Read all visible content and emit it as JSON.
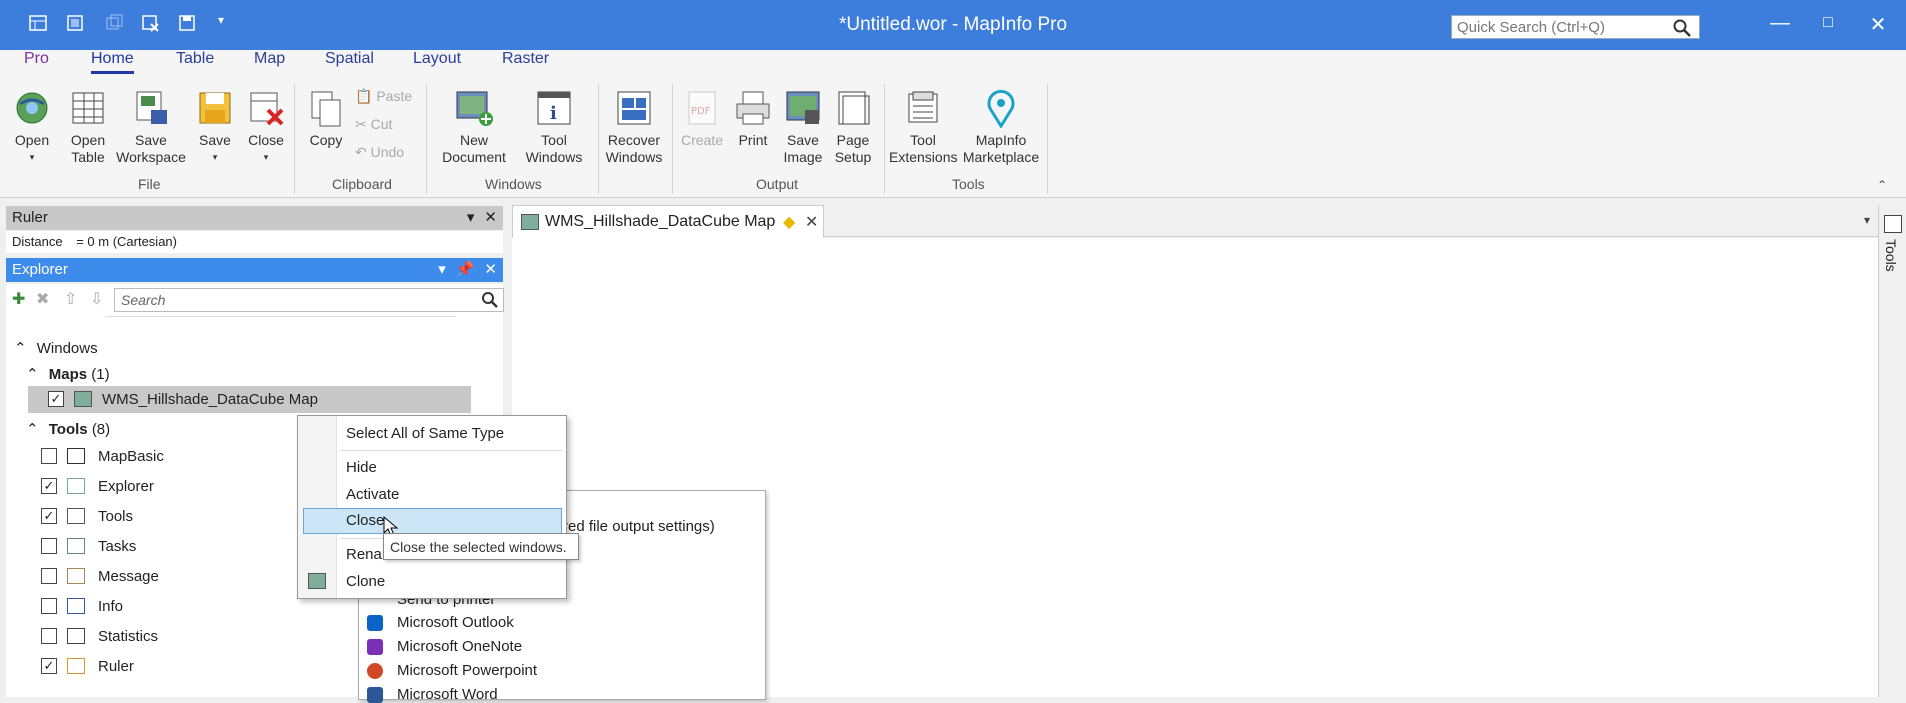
{
  "window": {
    "title": "*Untitled.wor - MapInfo Pro",
    "quick_search_placeholder": "Quick Search (Ctrl+Q)",
    "accent": "#3d7ddb"
  },
  "ribbon_tabs": [
    "Pro",
    "Home",
    "Table",
    "Map",
    "Spatial",
    "Layout",
    "Raster"
  ],
  "ribbon": {
    "file": {
      "label": "File",
      "open": "Open",
      "open_table": "Open Table",
      "save_workspace": "Save Workspace",
      "save": "Save",
      "close": "Close"
    },
    "clipboard": {
      "label": "Clipboard",
      "copy": "Copy",
      "paste": "Paste",
      "cut": "Cut",
      "undo": "Undo"
    },
    "windows": {
      "label": "Windows",
      "new_document": "New Document",
      "tool_windows": "Tool Windows",
      "recover_windows": "Recover Windows"
    },
    "output": {
      "label": "Output",
      "create": "Create",
      "print": "Print",
      "save_image": "Save Image",
      "page_setup": "Page Setup"
    },
    "tools": {
      "label": "Tools",
      "tool_extensions": "Tool Extensions",
      "marketplace": "MapInfo Marketplace"
    }
  },
  "ruler": {
    "title": "Ruler",
    "distance_label": "Distance",
    "distance_value": "= 0 m (Cartesian)"
  },
  "explorer": {
    "title": "Explorer",
    "search_placeholder": "Search",
    "windows_label": "Windows",
    "maps_label": "Maps",
    "maps_count": "(1)",
    "map_item": "WMS_Hillshade_DataCube Map",
    "tools_label": "Tools",
    "tools_count": "(8)",
    "tools": [
      {
        "name": "MapBasic",
        "checked": false
      },
      {
        "name": "Explorer",
        "checked": true
      },
      {
        "name": "Tools",
        "checked": true
      },
      {
        "name": "Tasks",
        "checked": false
      },
      {
        "name": "Message",
        "checked": false
      },
      {
        "name": "Info",
        "checked": false
      },
      {
        "name": "Statistics",
        "checked": false
      },
      {
        "name": "Ruler",
        "checked": true
      }
    ]
  },
  "document": {
    "tab_title": "WMS_Hillshade_DataCube Map",
    "right_strip_label": "Tools"
  },
  "background_menu": {
    "partial_1": ")",
    "partial_2": "red file output settings)",
    "partial_3": "Send to printer",
    "items": [
      {
        "label": "Microsoft Outlook",
        "color": "#0a64c8"
      },
      {
        "label": "Microsoft OneNote",
        "color": "#7b2fb5"
      },
      {
        "label": "Microsoft Powerpoint",
        "color": "#d24726"
      },
      {
        "label": "Microsoft Word",
        "color": "#2b5797"
      }
    ]
  },
  "context_menu": {
    "items": [
      "Select All of Same Type",
      "Hide",
      "Activate",
      "Close",
      "Renar",
      "Clone"
    ],
    "highlighted": "Close"
  },
  "tooltip": "Close the selected windows."
}
